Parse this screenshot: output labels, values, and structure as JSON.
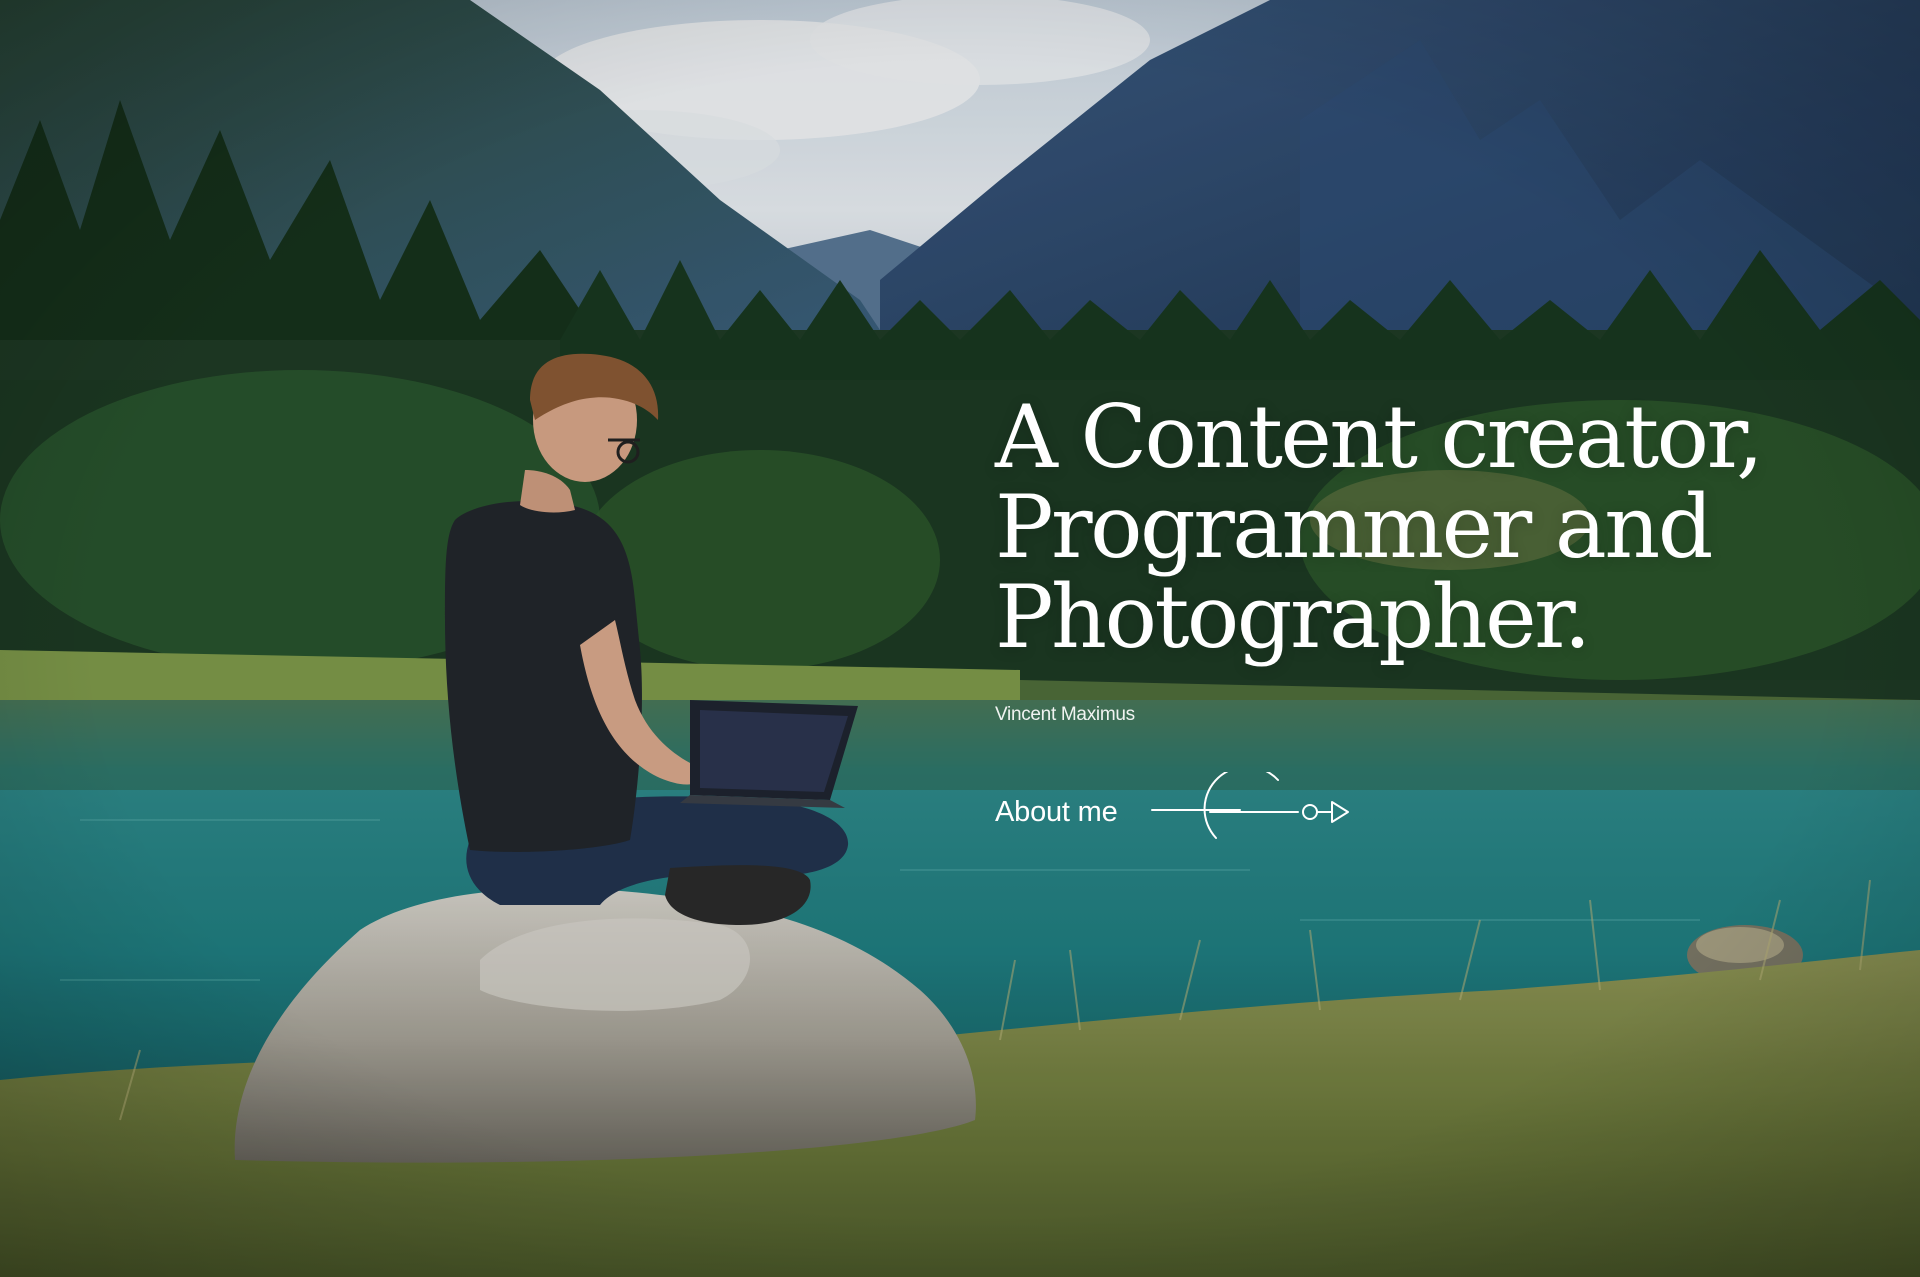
{
  "hero": {
    "headline_line1": "A Content creator,",
    "headline_line2": "Programmer and",
    "headline_line3": "Photographer.",
    "author": "Vincent Maximus",
    "about_label": "About me",
    "arrow_icon": "circle-arrow-right-icon"
  },
  "colors": {
    "text": "#ffffff",
    "sky": "#dfe7ee",
    "mountain": "#2e4a6e",
    "forest": "#1f3a23",
    "lake": "#2e8d8b",
    "grass": "#7e8a45",
    "rock": "#a9a59b"
  }
}
